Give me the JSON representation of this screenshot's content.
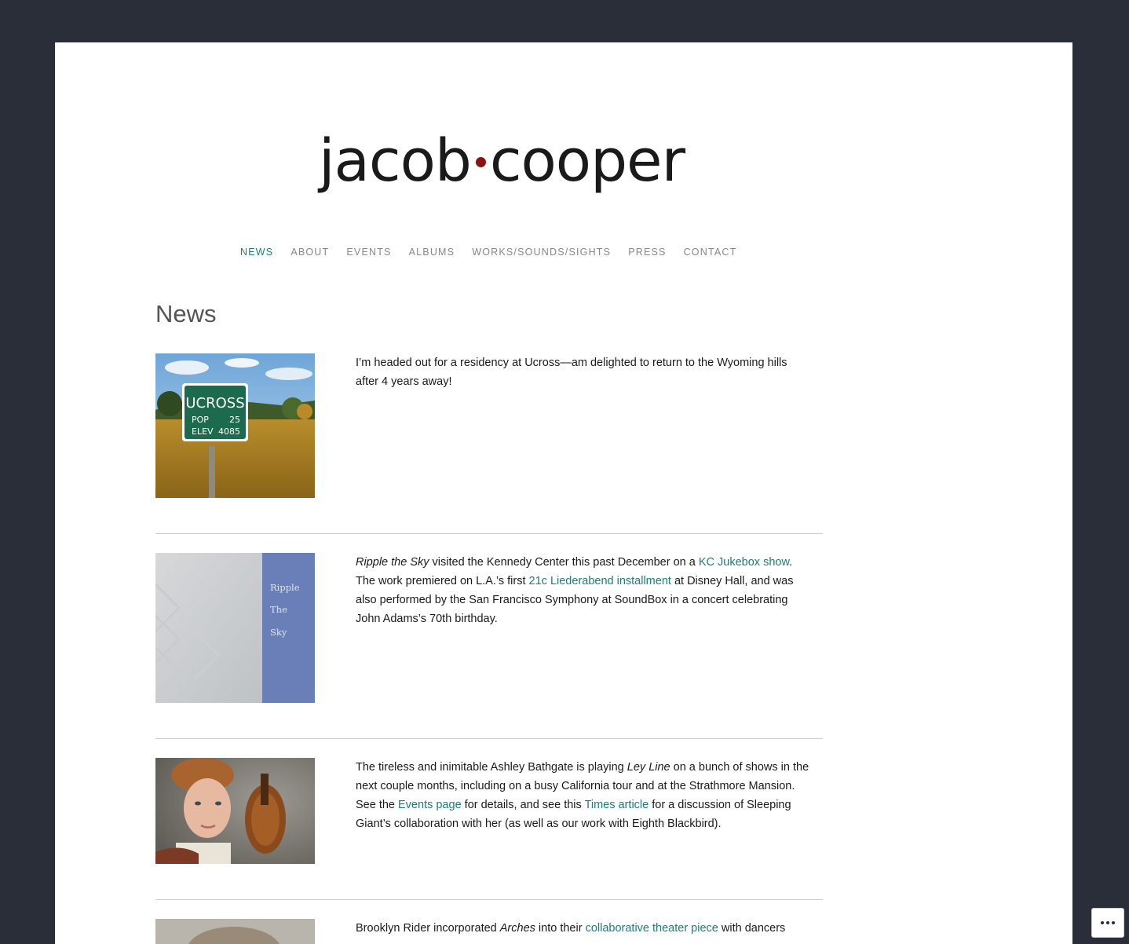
{
  "site": {
    "logo_left": "jacob",
    "logo_right": "cooper",
    "logo_dot_color": "#8c1111"
  },
  "nav": {
    "items": [
      "NEWS",
      "ABOUT",
      "EVENTS",
      "ALBUMS",
      "WORKS/SOUNDS/SIGHTS",
      "PRESS",
      "CONTACT"
    ],
    "active": "NEWS",
    "active_color": "#1c7c7c"
  },
  "page": {
    "title": "News"
  },
  "posts": [
    {
      "thumb": {
        "sign_title": "UCROSS",
        "sign_pop_label": "POP",
        "sign_pop_value": "25",
        "sign_elev_label": "ELEV",
        "sign_elev_value": "4085"
      },
      "p1": "I’m headed out for a residency at Ucross—am delighted to return to the Wyoming hills after 4 years away!"
    },
    {
      "thumb": {
        "line1": "Ripple",
        "line2": "The",
        "line3": "Sky"
      },
      "italic1": "Ripple the Sky",
      "t1": " visited the Kennedy Center this past December on a ",
      "link1": "KC Jukebox show",
      "t2": ".  The work premiered on L.A.’s first ",
      "link2": "21c Liederabend installment",
      "t3": " at Disney Hall, and was also performed by the San Francisco Symphony at SoundBox in a concert celebrating John Adams’s 70th birthday."
    },
    {
      "t1": "The tireless and inimitable Ashley Bathgate is playing ",
      "italic1": "Ley Line",
      "t2": " on a bunch of shows in the next couple months, including on a busy California tour and at the Strathmore Mansion. See the ",
      "link1": "Events page",
      "t3": " for details, and see this ",
      "link2": "Times article",
      "t4": " for a discussion of Sleeping Giant’s collaboration with her (as well as our work with Eighth Blackbird)."
    },
    {
      "t1": "Brooklyn Rider incorporated ",
      "italic1": "Arches",
      "t2": " into their ",
      "link1": "collaborative theater piece",
      "t3": " with dancers"
    }
  ],
  "icons": {
    "more": "ellipsis-icon"
  }
}
